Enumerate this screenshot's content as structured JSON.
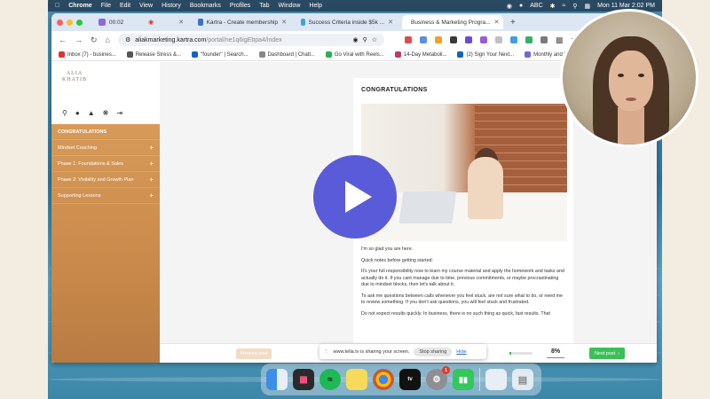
{
  "menubar": {
    "app": "Chrome",
    "menus": [
      "File",
      "Edit",
      "View",
      "History",
      "Bookmarks",
      "Profiles",
      "Tab",
      "Window",
      "Help"
    ],
    "input_label": "ABC",
    "clock": "Mon 11 Mar  2:02 PM"
  },
  "tabs": [
    {
      "label": "00:02",
      "active": false
    },
    {
      "label": "Kartra - Create membership",
      "active": false
    },
    {
      "label": "Success Criteria inside $5k ...",
      "active": false
    },
    {
      "label": "Business & Marketing Progra...",
      "active": true
    }
  ],
  "url": {
    "domain": "aliakmarketing.kartra.com",
    "path": "/portal/ne1q6igEbpa4/index"
  },
  "bookmarks": [
    "Inbox (7) - busines...",
    "Release Stress &...",
    "\"founder\" | Search...",
    "Dashboard | Chatl...",
    "Go Viral with Reels...",
    "14-Day Metaboli...",
    "(2) Sign Your Next...",
    "Monthly and Week..."
  ],
  "sidebar": {
    "logo_line1": "ALIA",
    "logo_line2": "KHATIB",
    "items": [
      {
        "label": "CONGRATULATIONS",
        "active": true
      },
      {
        "label": "Mindset Coaching",
        "active": false
      },
      {
        "label": "Phase 1: Foundations & Sales",
        "active": false
      },
      {
        "label": "Phase 2: Visibility and Growth Plan",
        "active": false
      },
      {
        "label": "Supporting Lessons",
        "active": false
      }
    ]
  },
  "content": {
    "title": "CONGRATULATIONS",
    "paragraphs": [
      "I'm so glad you are here.",
      "Quick notes before getting started:",
      "It's your full responsibility now to learn my course material and apply the homework and tasks and actually do it. If you cant manage due to time, previous commitments, or maybe procrastinating due to mindset blocks, then let's talk about it.",
      "To ask me questions between calls whenever you feel stuck, are not sure what to do, or need me to review something. If you don't ask questions, you will feel stuck and frustrated.",
      "Do not expect results quickly. In business, there is no such thing as quick, fast results. That"
    ]
  },
  "footer": {
    "prev_label": "Previous post",
    "progress_label": "8%",
    "progress_value": 0.08,
    "next_label": "Next post"
  },
  "sharing": {
    "message": "www.tella.tv is sharing your screen.",
    "stop_label": "Stop sharing",
    "hide_label": "Hide"
  },
  "dock": {
    "appletv_label": "tv",
    "badge": "1"
  },
  "colors": {
    "accent": "#5a5bd8",
    "sidebar": "#c9894a",
    "next": "#3cbf58"
  }
}
